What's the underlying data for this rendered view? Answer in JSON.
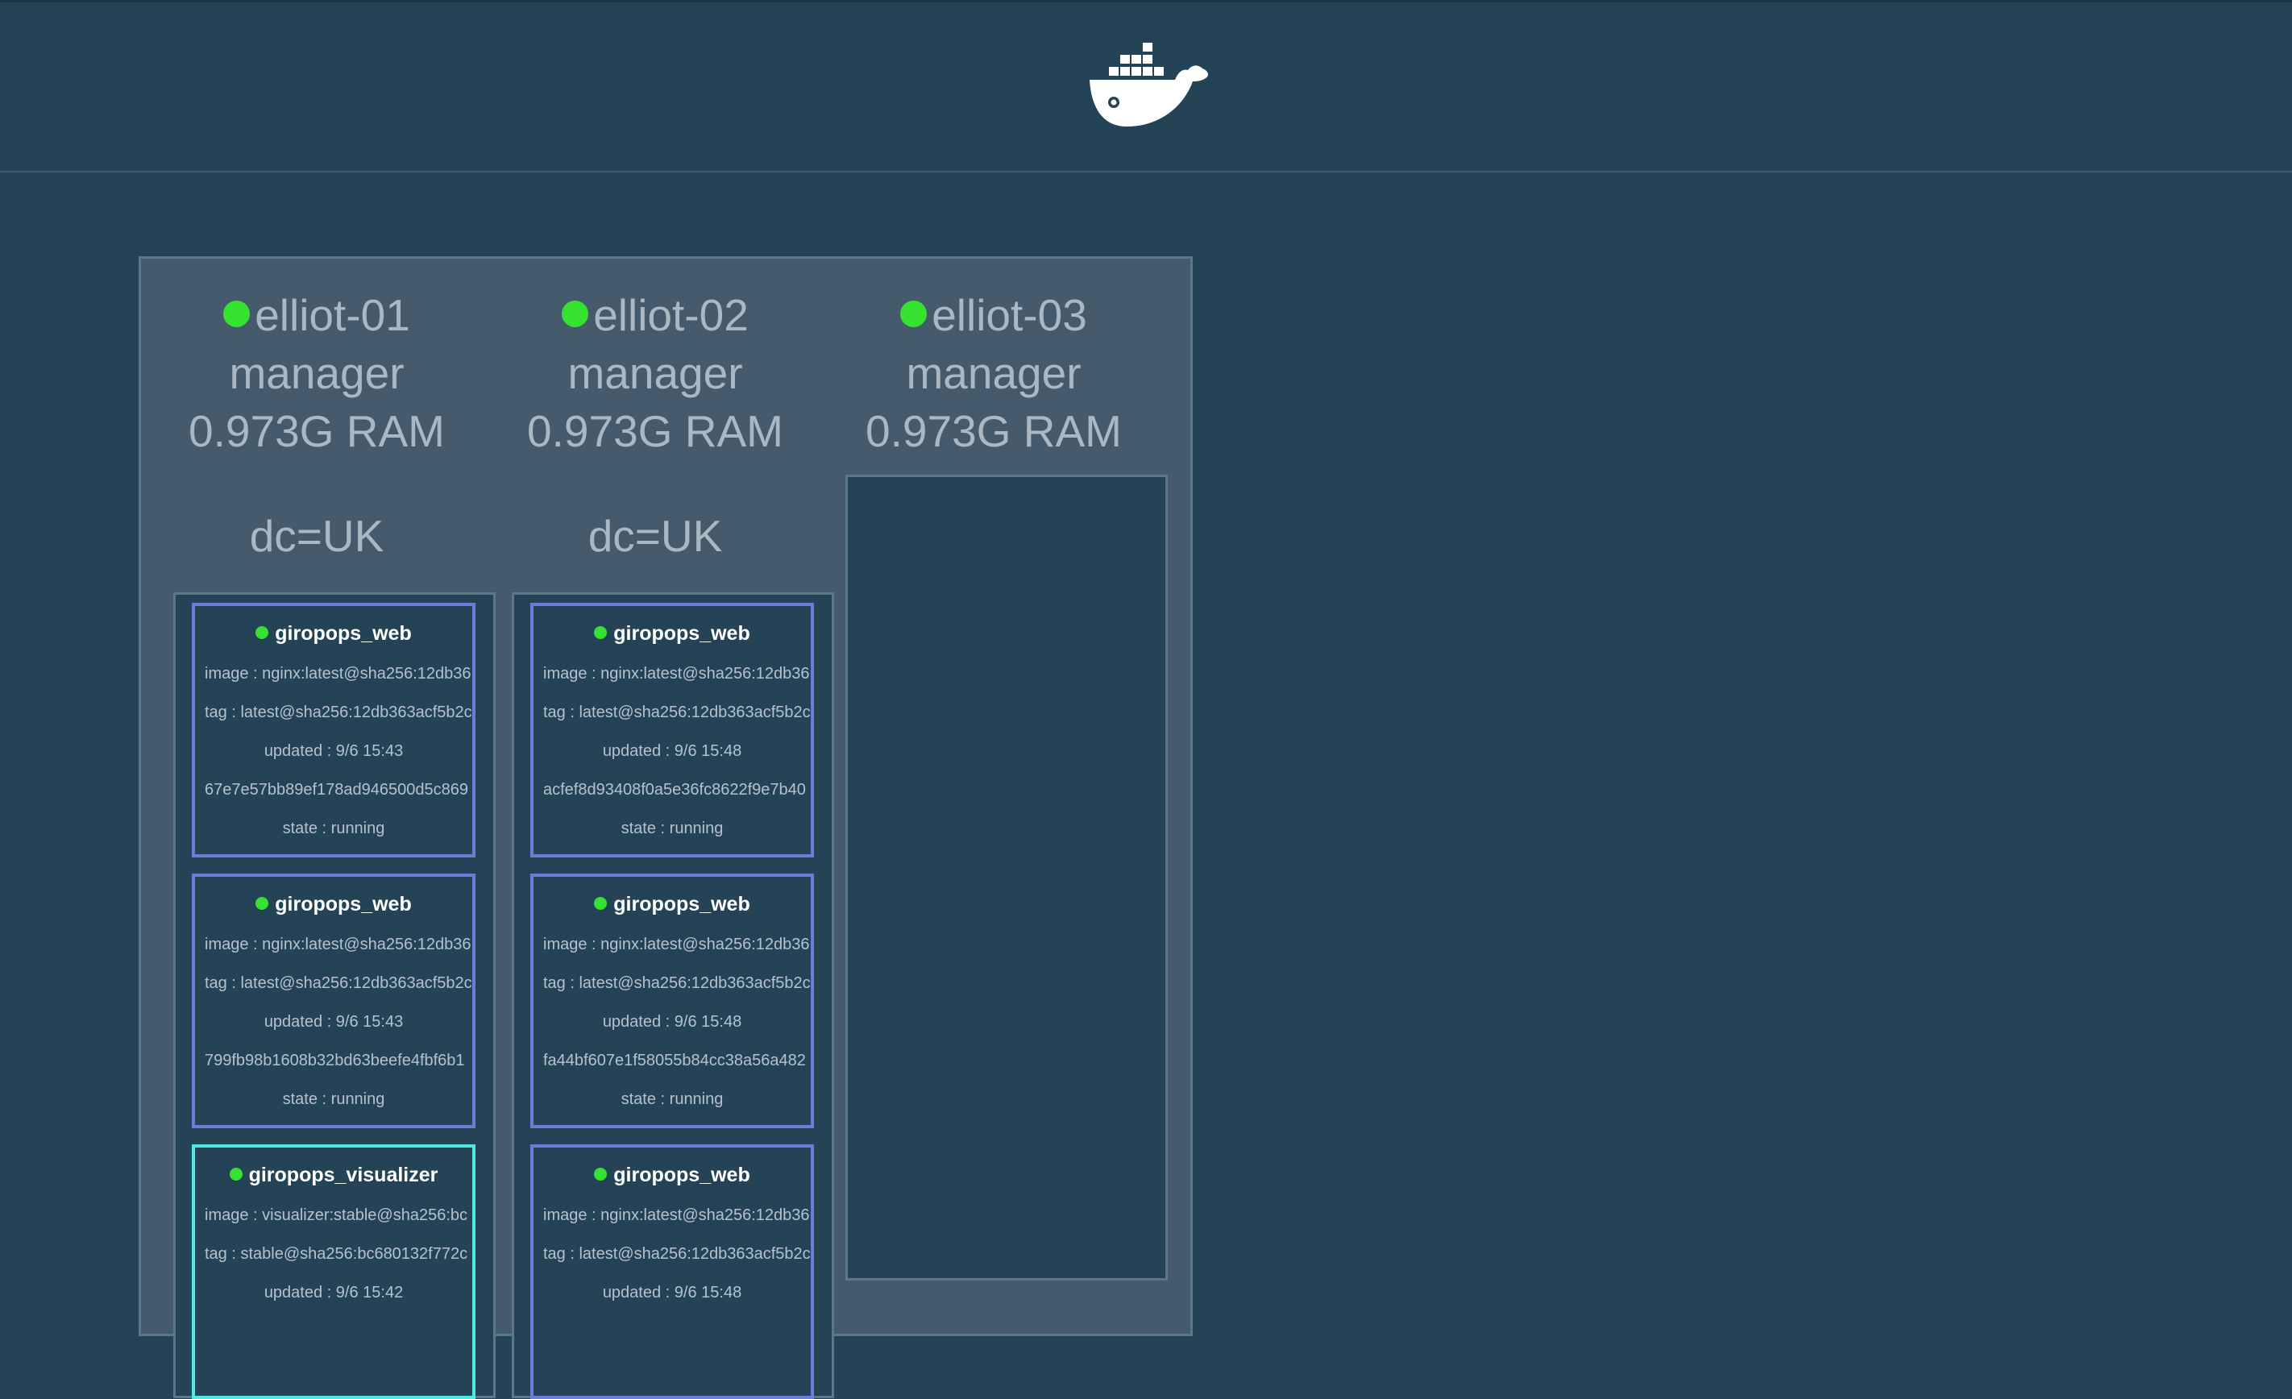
{
  "header": {
    "logo_icon": "docker-whale-icon"
  },
  "colors": {
    "background": "#254356",
    "panel": "#455b6b",
    "status_green": "#35e22f",
    "service_border_web": "#6d7bd9",
    "service_border_visualizer": "#4fe8e3"
  },
  "nodes": [
    {
      "name": "elliot-01",
      "role": "manager",
      "ram": "0.973G RAM",
      "label": "dc=UK",
      "tasks": [
        {
          "service": "giropops_web",
          "image": "image : nginx:latest@sha256:12db36",
          "tag": "tag : latest@sha256:12db363acf5b2c",
          "updated": "updated : 9/6 15:43",
          "id": "67e7e57bb89ef178ad946500d5c869",
          "state": "state : running"
        },
        {
          "service": "giropops_web",
          "image": "image : nginx:latest@sha256:12db36",
          "tag": "tag : latest@sha256:12db363acf5b2c",
          "updated": "updated : 9/6 15:43",
          "id": "799fb98b1608b32bd63beefe4fbf6b1",
          "state": "state : running"
        },
        {
          "service": "giropops_visualizer",
          "image": "image : visualizer:stable@sha256:bc",
          "tag": "tag : stable@sha256:bc680132f772c",
          "updated": "updated : 9/6 15:42",
          "id": "",
          "state": ""
        }
      ]
    },
    {
      "name": "elliot-02",
      "role": "manager",
      "ram": "0.973G RAM",
      "label": "dc=UK",
      "tasks": [
        {
          "service": "giropops_web",
          "image": "image : nginx:latest@sha256:12db36",
          "tag": "tag : latest@sha256:12db363acf5b2c",
          "updated": "updated : 9/6 15:48",
          "id": "acfef8d93408f0a5e36fc8622f9e7b40",
          "state": "state : running"
        },
        {
          "service": "giropops_web",
          "image": "image : nginx:latest@sha256:12db36",
          "tag": "tag : latest@sha256:12db363acf5b2c",
          "updated": "updated : 9/6 15:48",
          "id": "fa44bf607e1f58055b84cc38a56a482",
          "state": "state : running"
        },
        {
          "service": "giropops_web",
          "image": "image : nginx:latest@sha256:12db36",
          "tag": "tag : latest@sha256:12db363acf5b2c",
          "updated": "updated : 9/6 15:48",
          "id": "",
          "state": ""
        }
      ]
    },
    {
      "name": "elliot-03",
      "role": "manager",
      "ram": "0.973G RAM",
      "label": "",
      "tasks": []
    }
  ]
}
